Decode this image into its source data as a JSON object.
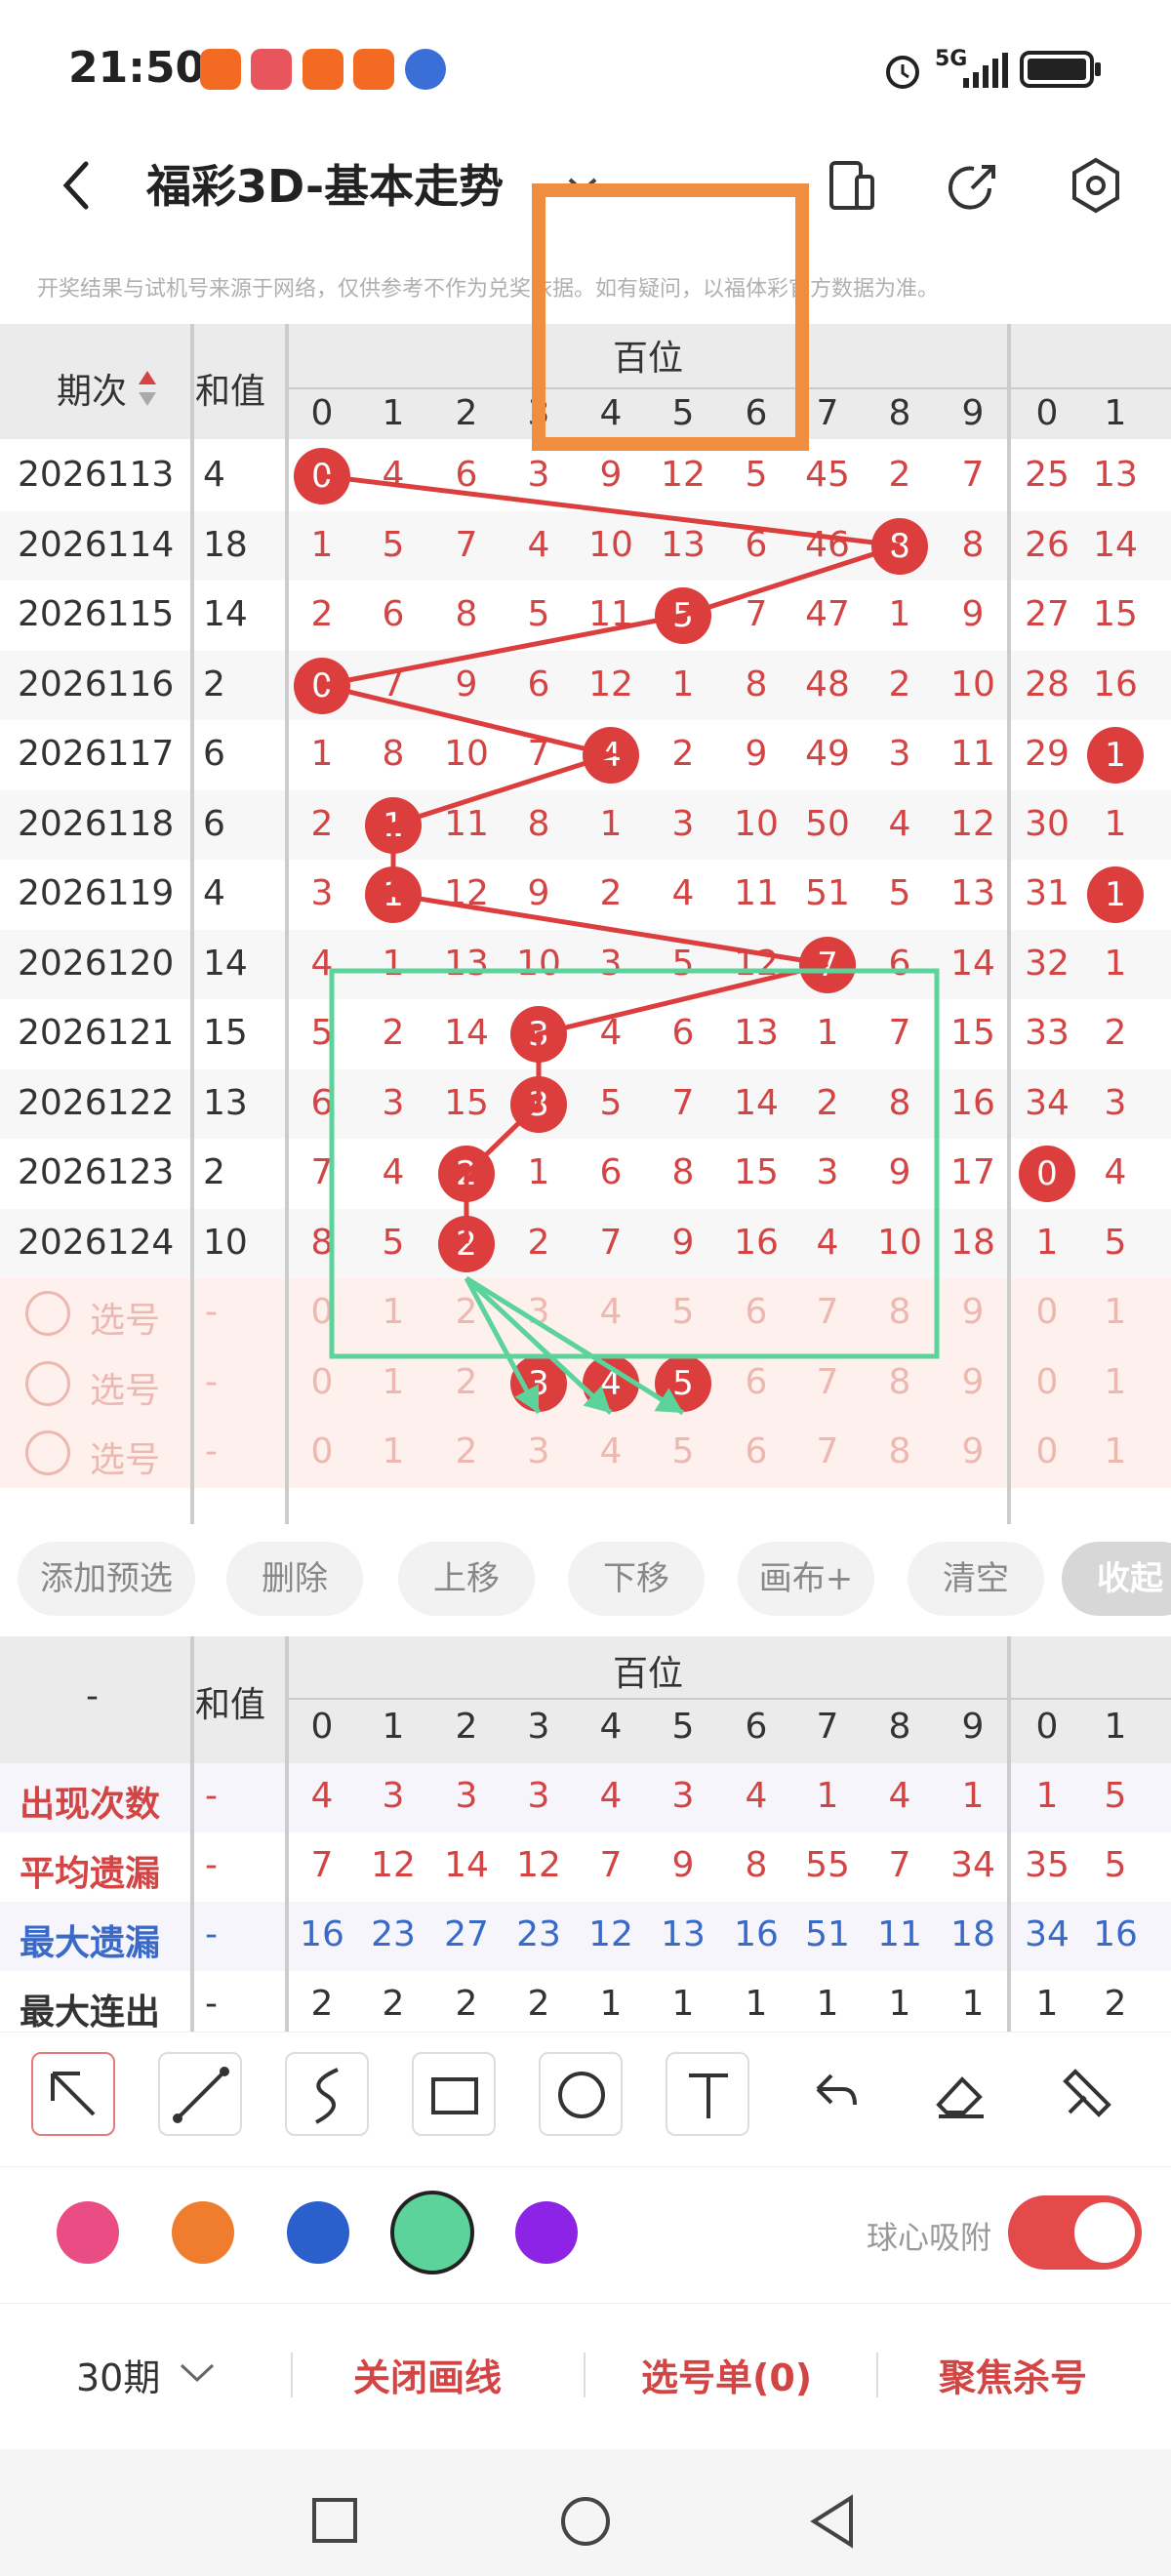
{
  "status_bar": {
    "time": "21:50",
    "network": "5G"
  },
  "title_bar": {
    "title": "福彩3D-基本走势",
    "icons": [
      "back-icon",
      "dropdown-icon",
      "phone-icon",
      "share-icon",
      "settings-icon"
    ]
  },
  "disclaimer": "开奖结果与试机号来源于网络，仅供参考不作为兑奖依据。如有疑问，以福体彩官方数据为准。",
  "trend_table": {
    "col_period": "期次",
    "col_sum": "和值",
    "group_label": "百位",
    "digit_headers": [
      "0",
      "1",
      "2",
      "3",
      "4",
      "5",
      "6",
      "7",
      "8",
      "9",
      "0",
      "1"
    ],
    "rows": [
      {
        "period": "2026113",
        "sum": "4",
        "cells": [
          "0",
          "4",
          "6",
          "3",
          "9",
          "12",
          "5",
          "45",
          "2",
          "7",
          "25",
          "13"
        ],
        "ball": 0
      },
      {
        "period": "2026114",
        "sum": "18",
        "cells": [
          "1",
          "5",
          "7",
          "4",
          "10",
          "13",
          "6",
          "46",
          "8",
          "8",
          "26",
          "14"
        ],
        "ball": 8
      },
      {
        "period": "2026115",
        "sum": "14",
        "cells": [
          "2",
          "6",
          "8",
          "5",
          "11",
          "5",
          "7",
          "47",
          "1",
          "9",
          "27",
          "15"
        ],
        "ball": 5
      },
      {
        "period": "2026116",
        "sum": "2",
        "cells": [
          "0",
          "7",
          "9",
          "6",
          "12",
          "1",
          "8",
          "48",
          "2",
          "10",
          "28",
          "16"
        ],
        "ball": 0
      },
      {
        "period": "2026117",
        "sum": "6",
        "cells": [
          "1",
          "8",
          "10",
          "7",
          "4",
          "2",
          "9",
          "49",
          "3",
          "11",
          "29",
          "1"
        ],
        "ball": 4,
        "ball2": 11
      },
      {
        "period": "2026118",
        "sum": "6",
        "cells": [
          "2",
          "1",
          "11",
          "8",
          "1",
          "3",
          "10",
          "50",
          "4",
          "12",
          "30",
          "1"
        ],
        "ball": 1
      },
      {
        "period": "2026119",
        "sum": "4",
        "cells": [
          "3",
          "1",
          "12",
          "9",
          "2",
          "4",
          "11",
          "51",
          "5",
          "13",
          "31",
          "1"
        ],
        "ball": 1,
        "ball2": 11
      },
      {
        "period": "2026120",
        "sum": "14",
        "cells": [
          "4",
          "1",
          "13",
          "10",
          "3",
          "5",
          "12",
          "7",
          "6",
          "14",
          "32",
          "1"
        ],
        "ball": 7
      },
      {
        "period": "2026121",
        "sum": "15",
        "cells": [
          "5",
          "2",
          "14",
          "3",
          "4",
          "6",
          "13",
          "1",
          "7",
          "15",
          "33",
          "2"
        ],
        "ball": 3
      },
      {
        "period": "2026122",
        "sum": "13",
        "cells": [
          "6",
          "3",
          "15",
          "3",
          "5",
          "7",
          "14",
          "2",
          "8",
          "16",
          "34",
          "3"
        ],
        "ball": 3
      },
      {
        "period": "2026123",
        "sum": "2",
        "cells": [
          "7",
          "4",
          "2",
          "1",
          "6",
          "8",
          "15",
          "3",
          "9",
          "17",
          "0",
          "4"
        ],
        "ball": 2,
        "ball2": 10
      },
      {
        "period": "2026124",
        "sum": "10",
        "cells": [
          "8",
          "5",
          "2",
          "2",
          "7",
          "9",
          "16",
          "4",
          "10",
          "18",
          "1",
          "5"
        ],
        "ball": 2
      }
    ],
    "pick_rows": [
      {
        "label": "选号",
        "sum": "-",
        "cells": [
          "0",
          "1",
          "2",
          "3",
          "4",
          "5",
          "6",
          "7",
          "8",
          "9",
          "0",
          "1"
        ],
        "balls": []
      },
      {
        "label": "选号",
        "sum": "-",
        "cells": [
          "0",
          "1",
          "2",
          "3",
          "4",
          "5",
          "6",
          "7",
          "8",
          "9",
          "0",
          "1"
        ],
        "balls": [
          3,
          4,
          5
        ]
      },
      {
        "label": "选号",
        "sum": "-",
        "cells": [
          "0",
          "1",
          "2",
          "3",
          "4",
          "5",
          "6",
          "7",
          "8",
          "9",
          "0",
          "1"
        ],
        "balls": []
      }
    ]
  },
  "action_buttons": [
    "添加预选",
    "删除",
    "上移",
    "下移",
    "画布+",
    "清空",
    "收起"
  ],
  "stats_table": {
    "col_period": "-",
    "col_sum": "和值",
    "group_label": "百位",
    "digit_headers": [
      "0",
      "1",
      "2",
      "3",
      "4",
      "5",
      "6",
      "7",
      "8",
      "9",
      "0",
      "1"
    ],
    "rows": [
      {
        "label": "出现次数",
        "sum": "-",
        "cells": [
          "4",
          "3",
          "3",
          "3",
          "4",
          "3",
          "4",
          "1",
          "4",
          "1",
          "1",
          "5"
        ],
        "color": "red"
      },
      {
        "label": "平均遗漏",
        "sum": "-",
        "cells": [
          "7",
          "12",
          "14",
          "12",
          "7",
          "9",
          "8",
          "55",
          "7",
          "34",
          "35",
          "5"
        ],
        "color": "red"
      },
      {
        "label": "最大遗漏",
        "sum": "-",
        "cells": [
          "16",
          "23",
          "27",
          "23",
          "12",
          "13",
          "16",
          "51",
          "11",
          "18",
          "34",
          "16"
        ],
        "color": "blue"
      },
      {
        "label": "最大连出",
        "sum": "-",
        "cells": [
          "2",
          "2",
          "2",
          "2",
          "1",
          "1",
          "1",
          "1",
          "1",
          "1",
          "1",
          "2"
        ],
        "color": "dark"
      }
    ]
  },
  "draw_tools": [
    "arrow-tool-icon",
    "line-tool-icon",
    "curve-tool-icon",
    "rect-tool-icon",
    "circle-tool-icon",
    "text-tool-icon",
    "undo-icon",
    "eraser-icon",
    "brush-icon"
  ],
  "colors": [
    "#ea4d84",
    "#ef7d2d",
    "#2a5fcc",
    "#5bd39b",
    "#8d24e5"
  ],
  "snap_label": "球心吸附",
  "snap_on": true,
  "bottom_bar": {
    "periods": "30期",
    "close_lines": "关闭画线",
    "pick_list": "选号单(0)",
    "focus": "聚焦杀号"
  }
}
